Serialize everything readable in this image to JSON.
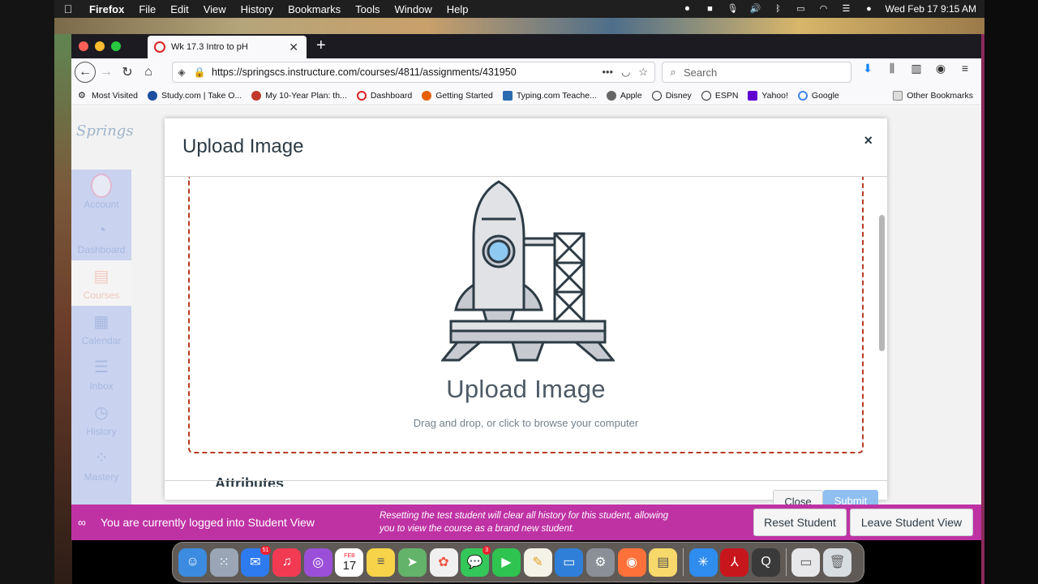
{
  "menubar": {
    "app": "Firefox",
    "menus": [
      "File",
      "Edit",
      "View",
      "History",
      "Bookmarks",
      "Tools",
      "Window",
      "Help"
    ],
    "datetime": "Wed Feb 17  9:15 AM"
  },
  "browser": {
    "tab_title": "Wk 17.3 Intro to pH",
    "url": "https://springscs.instructure.com/courses/4811/assignments/431950",
    "search_placeholder": "Search",
    "bookmarks": [
      "Most Visited",
      "Study.com | Take O...",
      "My 10-Year Plan: th...",
      "Dashboard",
      "Getting Started",
      "Typing.com Teache...",
      "Apple",
      "Disney",
      "ESPN",
      "Yahoo!",
      "Google"
    ],
    "other_bookmarks": "Other Bookmarks"
  },
  "site": {
    "logo": "Springs",
    "nav": [
      {
        "label": "Account",
        "icon": "account-avatar"
      },
      {
        "label": "Dashboard",
        "icon": "dashboard-gauge"
      },
      {
        "label": "Courses",
        "icon": "book"
      },
      {
        "label": "Calendar",
        "icon": "calendar"
      },
      {
        "label": "Inbox",
        "icon": "inbox-tray"
      },
      {
        "label": "History",
        "icon": "clock"
      },
      {
        "label": "Mastery",
        "icon": "mastery-nodes"
      }
    ]
  },
  "modal": {
    "title": "Upload Image",
    "close_symbol": "×",
    "dropzone_title": "Upload Image",
    "dropzone_subtitle": "Drag and drop, or click to browse your computer",
    "attributes_heading": "Attributes",
    "close_button": "Close",
    "submit_button": "Submit"
  },
  "student_view": {
    "message": "You are currently logged into Student View",
    "note": "Resetting the test student will clear all history for this student, allowing you to view the course as a brand new student.",
    "reset_button": "Reset Student",
    "leave_button": "Leave Student View"
  },
  "dock": {
    "mail_badge": "51",
    "messages_badge": "3",
    "calendar_month": "FEB",
    "calendar_day": "17"
  },
  "colors": {
    "banner": "#bf32a4",
    "dropzone_border": "#b73b23",
    "nav_bg": "#c9d3ef",
    "submit": "#8fbff0"
  }
}
